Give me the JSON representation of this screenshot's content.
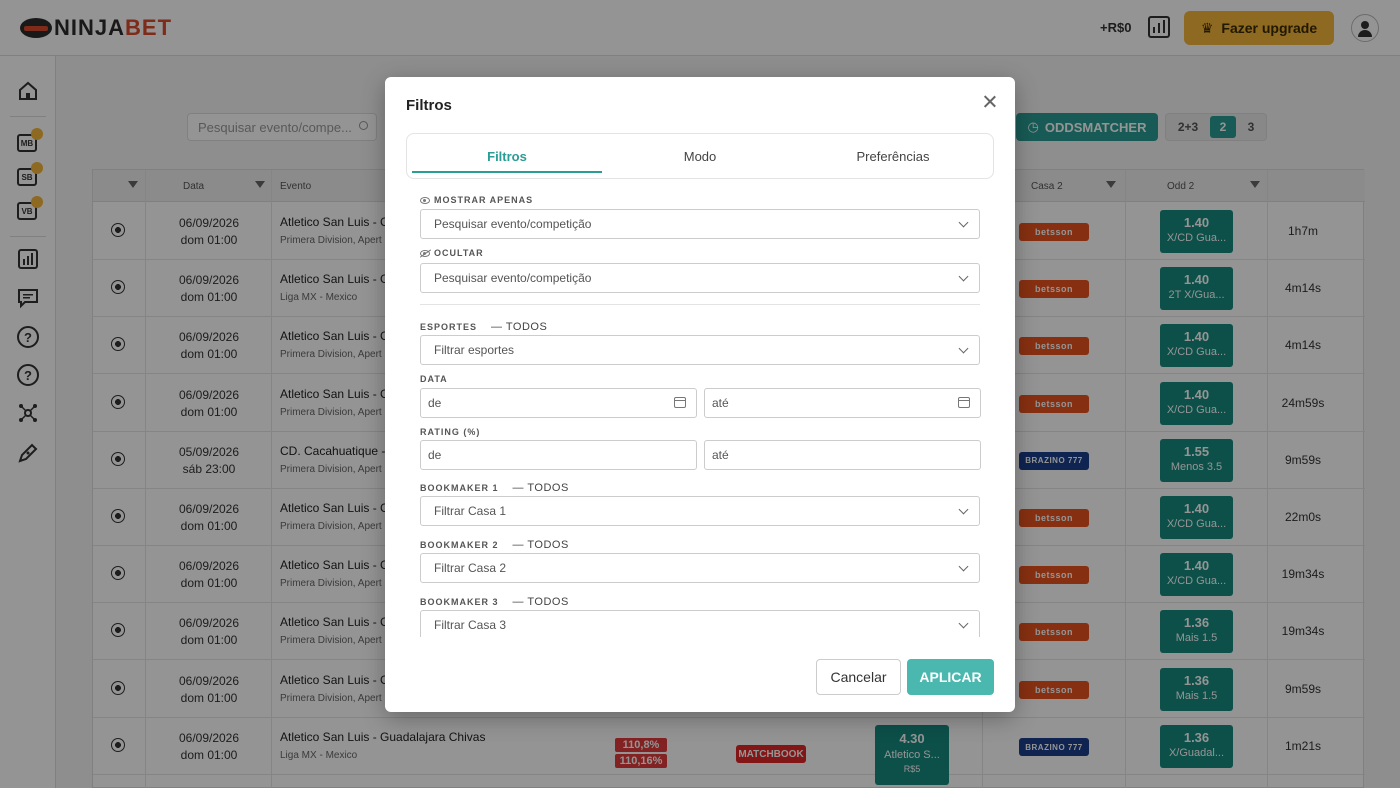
{
  "brand": {
    "name_a": "NINJA",
    "name_b": "BET"
  },
  "header": {
    "balance": "+R$0",
    "upgrade_label": "Fazer upgrade",
    "upgrade_icon": "crown-icon"
  },
  "sidebar": {
    "items": [
      {
        "name": "home",
        "icon": "home-icon"
      },
      {
        "name": "mb",
        "label": "MB"
      },
      {
        "name": "sb",
        "label": "SB"
      },
      {
        "name": "vb",
        "label": "VB"
      },
      {
        "name": "stats",
        "icon": "bar-chart-icon"
      },
      {
        "name": "chat",
        "icon": "chat-icon"
      },
      {
        "name": "help1",
        "label": "?"
      },
      {
        "name": "help2",
        "label": "?"
      },
      {
        "name": "network",
        "icon": "network-icon"
      },
      {
        "name": "edit",
        "icon": "pen-icon"
      }
    ]
  },
  "toolbar": {
    "search_placeholder": "Pesquisar evento/compe...",
    "oddsmatcher_label": "ODDSMATCHER",
    "pages": [
      "2+3",
      "2",
      "3"
    ],
    "active_page": "2"
  },
  "table": {
    "headers": {
      "date": "Data",
      "event": "Evento",
      "bookmaker2": "Casa 2",
      "odd2": "Odd 2"
    },
    "rows": [
      {
        "date": "06/09/2026",
        "time": "dom 01:00",
        "event": "Atletico San Luis - CD",
        "league": "Primera Division, Apert",
        "bk2": "betsson",
        "odd2": "1.40",
        "market": "X/CD Gua...",
        "elapsed": "1h7m"
      },
      {
        "date": "06/09/2026",
        "time": "dom 01:00",
        "event": "Atletico San Luis - Gu",
        "league": "Liga MX - Mexico",
        "bk2": "betsson",
        "odd2": "1.40",
        "market": "2T X/Gua...",
        "elapsed": "4m14s"
      },
      {
        "date": "06/09/2026",
        "time": "dom 01:00",
        "event": "Atletico San Luis - CD",
        "league": "Primera Division, Apert",
        "bk2": "betsson",
        "odd2": "1.40",
        "market": "X/CD Gua...",
        "elapsed": "4m14s"
      },
      {
        "date": "06/09/2026",
        "time": "dom 01:00",
        "event": "Atletico San Luis - CD",
        "league": "Primera Division, Apert",
        "bk2": "betsson",
        "odd2": "1.40",
        "market": "X/CD Gua...",
        "elapsed": "24m59s"
      },
      {
        "date": "05/09/2026",
        "time": "sáb 23:00",
        "event": "CD. Cacahuatique - C",
        "league": "Primera Division, Apert",
        "bk2": "BRAZINO 777",
        "odd2": "1.55",
        "market": "Menos 3.5",
        "elapsed": "9m59s"
      },
      {
        "date": "06/09/2026",
        "time": "dom 01:00",
        "event": "Atletico San Luis - CD",
        "league": "Primera Division, Apert",
        "bk2": "betsson",
        "odd2": "1.40",
        "market": "X/CD Gua...",
        "elapsed": "22m0s"
      },
      {
        "date": "06/09/2026",
        "time": "dom 01:00",
        "event": "Atletico San Luis - CD",
        "league": "Primera Division, Apert",
        "bk2": "betsson",
        "odd2": "1.40",
        "market": "X/CD Gua...",
        "elapsed": "19m34s"
      },
      {
        "date": "06/09/2026",
        "time": "dom 01:00",
        "event": "Atletico San Luis - CD",
        "league": "Primera Division, Apert",
        "bk2": "betsson",
        "odd2": "1.36",
        "market": "Mais 1.5",
        "elapsed": "19m34s"
      },
      {
        "date": "06/09/2026",
        "time": "dom 01:00",
        "event": "Atletico San Luis - CD",
        "league": "Primera Division, Apert",
        "bk2": "betsson",
        "odd2": "1.36",
        "market": "Mais 1.5",
        "elapsed": "9m59s"
      }
    ],
    "last_row": {
      "date": "06/09/2026",
      "time": "dom 01:00",
      "event": "Atletico San Luis - Guadalajara Chivas",
      "league": "Liga MX - Mexico",
      "pct1": "110,8%",
      "pct2": "110,16%",
      "bk1": "MATCHBOOK",
      "odd1": "4.30",
      "market1": "Atletico S...",
      "stake1": "R$5",
      "bk2": "BRAZINO 777",
      "odd2": "1.36",
      "market2": "X/Guadal...",
      "elapsed": "1m21s"
    }
  },
  "modal": {
    "title": "Filtros",
    "tabs": [
      "Filtros",
      "Modo",
      "Preferências"
    ],
    "active_tab": "Filtros",
    "show_only": {
      "label": "MOSTRAR APENAS",
      "placeholder": "Pesquisar evento/competição"
    },
    "hide": {
      "label": "OCULTAR",
      "placeholder": "Pesquisar evento/competição"
    },
    "sports": {
      "label": "ESPORTES",
      "todos": "— TODOS",
      "placeholder": "Filtrar esportes"
    },
    "date": {
      "label": "DATA",
      "from": "de",
      "to": "até"
    },
    "rating": {
      "label": "RATING (%)",
      "from": "de",
      "to": "até"
    },
    "bookmaker1": {
      "label": "BOOKMAKER 1",
      "todos": "— TODOS",
      "placeholder": "Filtrar Casa 1"
    },
    "bookmaker2": {
      "label": "BOOKMAKER 2",
      "todos": "— TODOS",
      "placeholder": "Filtrar Casa 2"
    },
    "bookmaker3": {
      "label": "BOOKMAKER 3",
      "todos": "— TODOS",
      "placeholder": "Filtrar Casa 3"
    },
    "cancel_label": "Cancelar",
    "apply_label": "APLICAR"
  },
  "colors": {
    "accent": "#2a9d94",
    "apply": "#4bb8b0",
    "upgrade": "#f4b63a",
    "betsson": "#e8541e",
    "brazino": "#1a3e8c"
  }
}
